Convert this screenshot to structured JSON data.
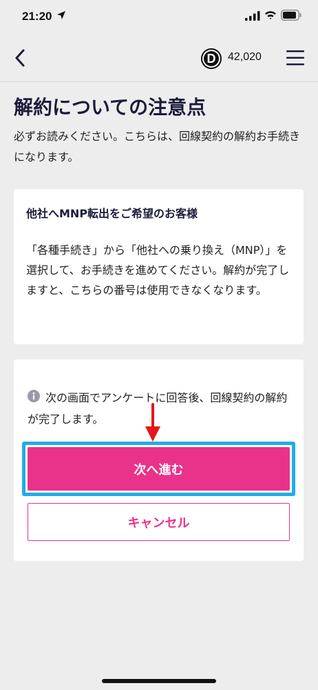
{
  "status_bar": {
    "time": "21:20"
  },
  "header": {
    "points_badge_letter": "D",
    "points_value": "42,020"
  },
  "page": {
    "title": "解約についての注意点",
    "intro": "必ずお読みください。こちらは、回線契約の解約お手続きになります。"
  },
  "mnp_notice": {
    "title": "他社へMNP転出をご希望のお客様",
    "body": "「各種手続き」から「他社への乗り換え（MNP）」を選択して、お手続きを進めてください。解約が完了しますと、こちらの番号は使用できなくなります。"
  },
  "actions": {
    "info_text": "次の画面でアンケートに回答後、回線契約の解約が完了します。",
    "next_label": "次へ進む",
    "cancel_label": "キャンセル"
  },
  "colors": {
    "accent": "#e9338a",
    "highlight": "#1faee6",
    "annotation_arrow": "#e8151b",
    "background": "#ededed"
  },
  "icons": {
    "back": "chevron-left-icon",
    "menu": "hamburger-menu-icon",
    "info": "info-circle-icon"
  }
}
